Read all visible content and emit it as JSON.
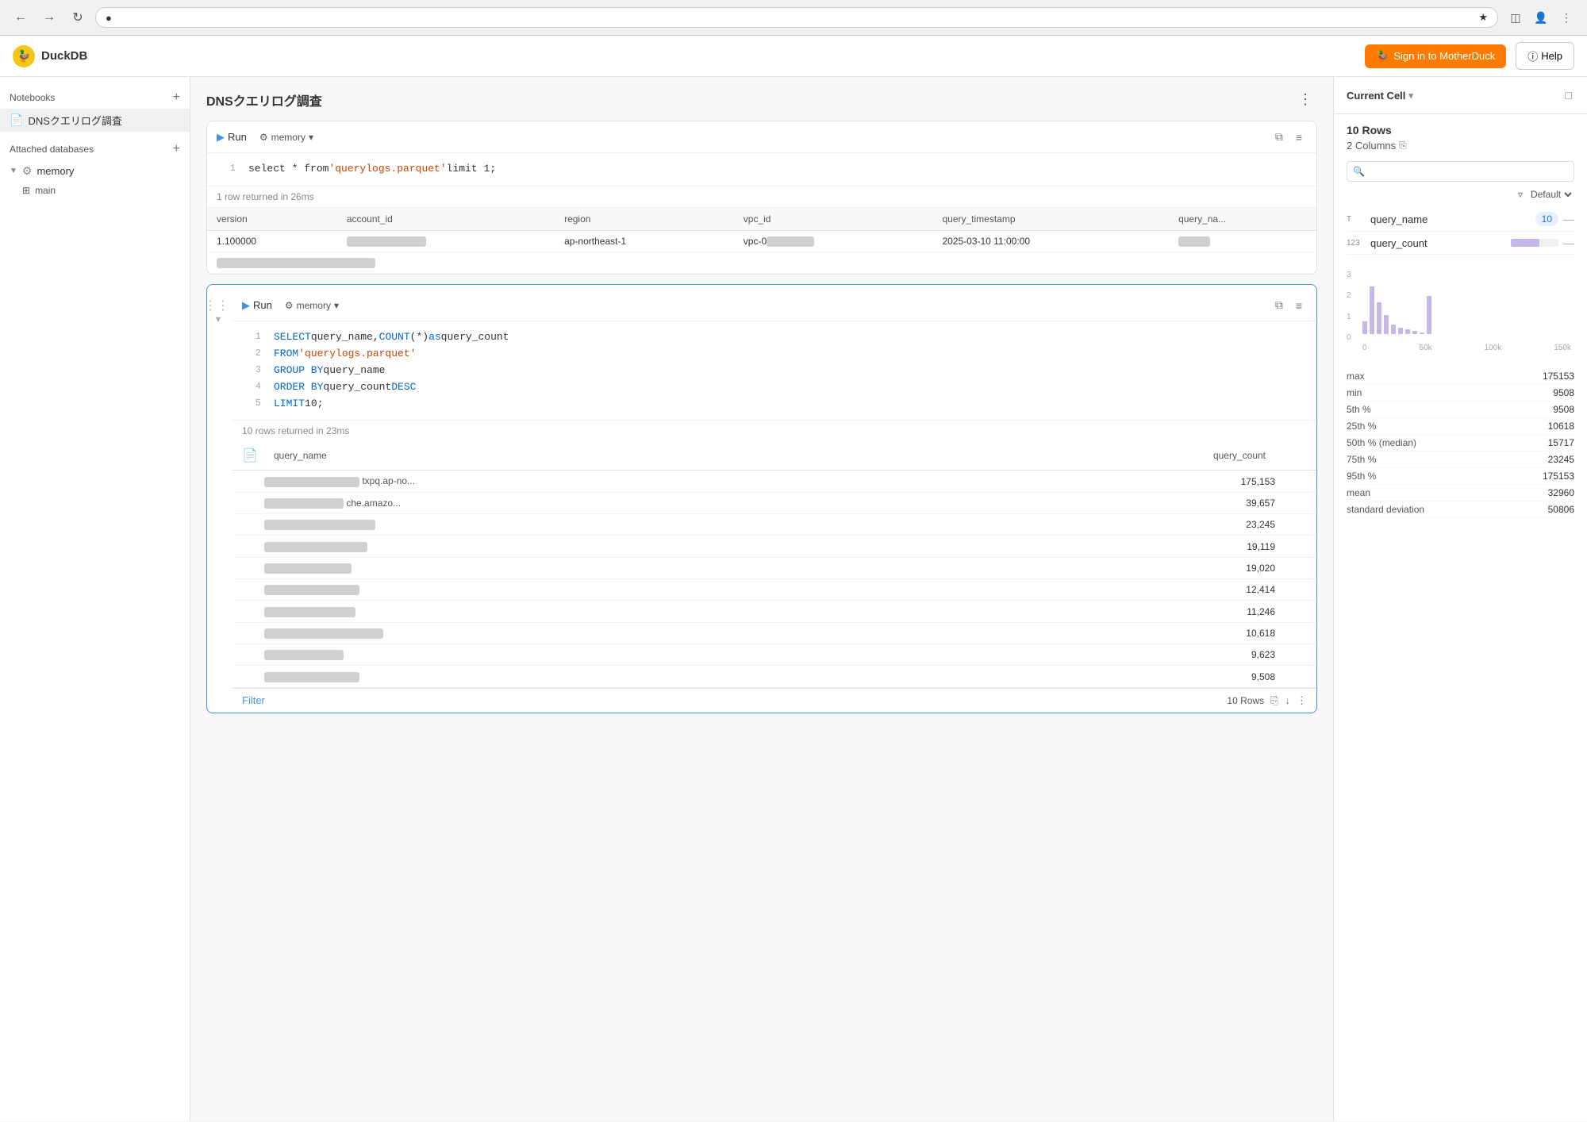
{
  "browser": {
    "url": "localhost:4213",
    "back_enabled": true,
    "forward_enabled": false
  },
  "app": {
    "name": "DuckDB",
    "sign_in_label": "Sign in to MotherDuck",
    "help_label": "Help"
  },
  "sidebar": {
    "notebooks_label": "Notebooks",
    "notebook_name": "DNSクエリログ調査",
    "attached_databases_label": "Attached databases",
    "memory_label": "memory",
    "main_label": "main"
  },
  "notebook": {
    "title": "DNSクエリログ調査"
  },
  "cell1": {
    "run_label": "Run",
    "db_label": "memory",
    "result_info": "1 row returned in 26ms",
    "code": [
      {
        "line": 1,
        "parts": [
          {
            "type": "plain",
            "text": "select * from "
          },
          {
            "type": "str",
            "text": "'querylogs.parquet'"
          },
          {
            "type": "plain",
            "text": " limit 1;"
          }
        ]
      }
    ],
    "table": {
      "columns": [
        "version",
        "account_id",
        "region",
        "vpc_id",
        "query_timestamp",
        "query_na..."
      ],
      "rows": [
        [
          "1.100000",
          "BLURRED_ACCT",
          "ap-northeast-1",
          "vpc-0BLURRED",
          "2025-03-10 11:00:00",
          "BLURRED"
        ]
      ]
    }
  },
  "cell2": {
    "run_label": "Run",
    "db_label": "memory",
    "result_info": "10 rows returned in 23ms",
    "code": [
      {
        "line": 1,
        "parts": [
          {
            "type": "kw",
            "text": "SELECT "
          },
          {
            "type": "plain",
            "text": "query_name, "
          },
          {
            "type": "fn",
            "text": "COUNT"
          },
          {
            "type": "plain",
            "text": "(*) "
          },
          {
            "type": "kw",
            "text": "as"
          },
          {
            "type": "plain",
            "text": " query_count"
          }
        ]
      },
      {
        "line": 2,
        "parts": [
          {
            "type": "kw",
            "text": "FROM "
          },
          {
            "type": "str",
            "text": "'querylogs.parquet'"
          }
        ]
      },
      {
        "line": 3,
        "parts": [
          {
            "type": "kw",
            "text": "GROUP BY"
          },
          {
            "type": "plain",
            "text": " query_name"
          }
        ]
      },
      {
        "line": 4,
        "parts": [
          {
            "type": "kw",
            "text": "ORDER BY"
          },
          {
            "type": "plain",
            "text": " query_count "
          },
          {
            "type": "kw",
            "text": "DESC"
          }
        ]
      },
      {
        "line": 5,
        "parts": [
          {
            "type": "kw",
            "text": "LIMIT"
          },
          {
            "type": "plain",
            "text": " 10;"
          }
        ]
      }
    ],
    "table": {
      "columns": [
        "query_name",
        "query_count"
      ],
      "rows": [
        {
          "name_suffix": "txpq.ap-no...",
          "count": "175,153"
        },
        {
          "name_suffix": "che.amazo...",
          "count": "39,657"
        },
        {
          "name_suffix": "",
          "count": "23,245"
        },
        {
          "name_suffix": "",
          "count": "19,119"
        },
        {
          "name_suffix": "",
          "count": "19,020"
        },
        {
          "name_suffix": "",
          "count": "12,414"
        },
        {
          "name_suffix": "",
          "count": "11,246"
        },
        {
          "name_suffix": "",
          "count": "10,618"
        },
        {
          "name_suffix": "",
          "count": "9,623"
        },
        {
          "name_suffix": "",
          "count": "9,508"
        }
      ]
    },
    "filter_label": "Filter",
    "rows_label": "10 Rows"
  },
  "right_panel": {
    "title": "Current Cell",
    "rows_label": "10 Rows",
    "columns_label": "2 Columns",
    "filter_label": "Default",
    "columns": [
      {
        "type": "T",
        "name": "query_name",
        "value": "10"
      },
      {
        "type": "123",
        "name": "query_count",
        "bar_pct": 60
      }
    ],
    "histogram": {
      "y_labels": [
        "3",
        "2",
        "1",
        "0"
      ],
      "x_labels": [
        "0",
        "50k",
        "100k",
        "150k"
      ],
      "bars": [
        18,
        75,
        45,
        25,
        8,
        5,
        3,
        2,
        1,
        60
      ]
    },
    "stats": [
      {
        "label": "max",
        "value": "175153"
      },
      {
        "label": "min",
        "value": "9508"
      },
      {
        "label": "5th %",
        "value": "9508"
      },
      {
        "label": "25th %",
        "value": "10618"
      },
      {
        "label": "50th % (median)",
        "value": "15717"
      },
      {
        "label": "75th %",
        "value": "23245"
      },
      {
        "label": "95th %",
        "value": "175153"
      },
      {
        "label": "mean",
        "value": "32960"
      },
      {
        "label": "standard deviation",
        "value": "50806"
      }
    ]
  }
}
